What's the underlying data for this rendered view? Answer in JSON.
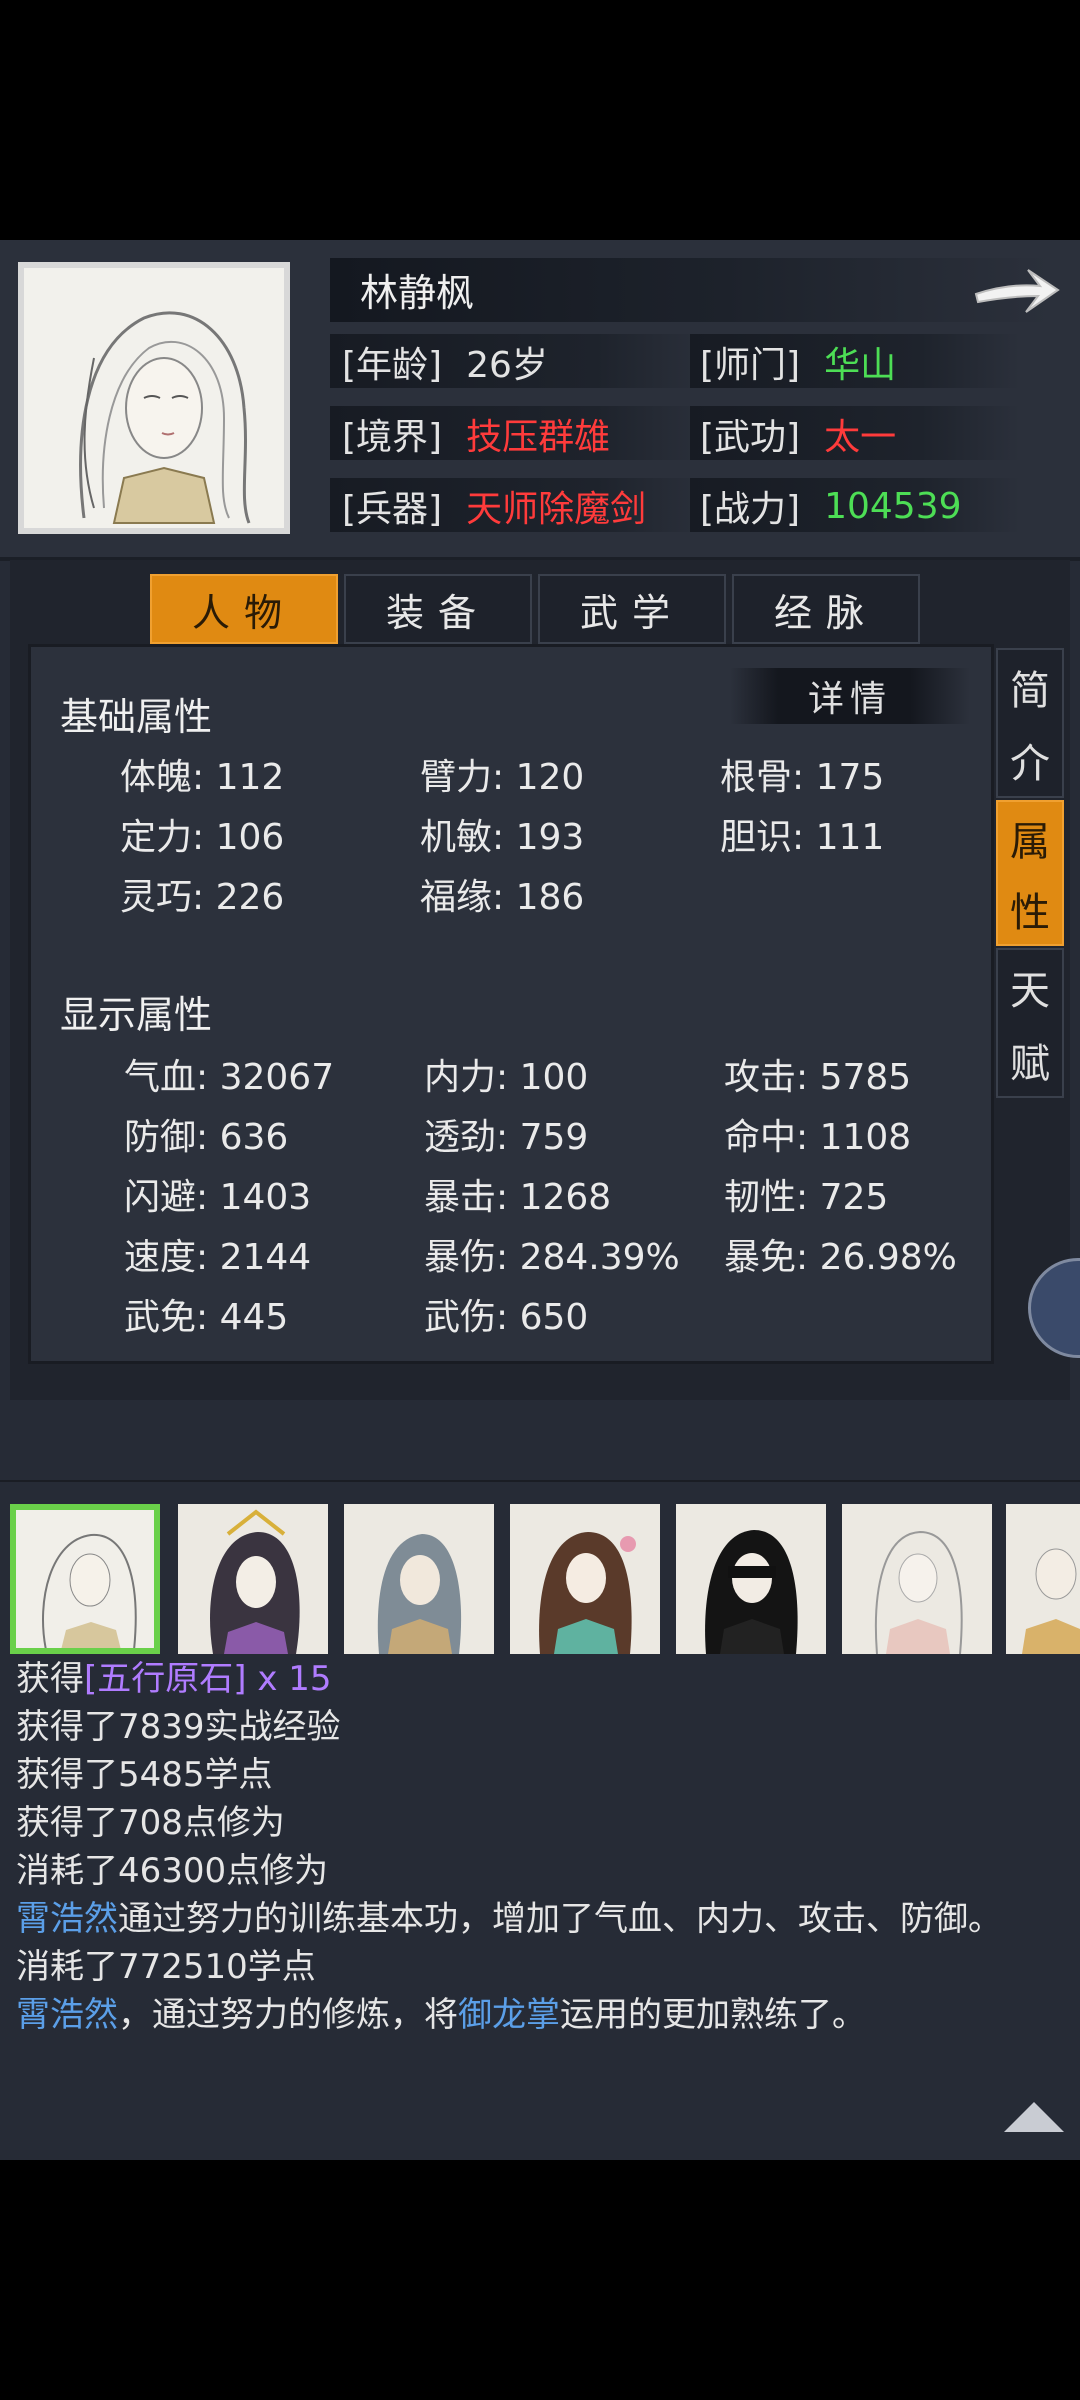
{
  "header": {
    "name": "林静枫",
    "age_label": "[年龄]",
    "age_value": "26岁",
    "sect_label": "[师门]",
    "sect_value": "华山",
    "realm_label": "[境界]",
    "realm_value": "技压群雄",
    "skill_label": "[武功]",
    "skill_value": "太一",
    "weapon_label": "[兵器]",
    "weapon_value": "天师除魔剑",
    "power_label": "[战力]",
    "power_value": "104539"
  },
  "tabs": [
    {
      "label": "人物",
      "active": true
    },
    {
      "label": "装备",
      "active": false
    },
    {
      "label": "武学",
      "active": false
    },
    {
      "label": "经脉",
      "active": false
    }
  ],
  "side_tabs": [
    {
      "label": [
        "简",
        "介"
      ],
      "active": false
    },
    {
      "label": [
        "属",
        "性"
      ],
      "active": true
    },
    {
      "label": [
        "天",
        "赋"
      ],
      "active": false
    }
  ],
  "details_label": "详情",
  "basic": {
    "title": "基础属性",
    "stats": [
      "体魄: 112",
      "臂力: 120",
      "根骨: 175",
      "定力: 106",
      "机敏: 193",
      "胆识: 111",
      "灵巧: 226",
      "福缘: 186"
    ]
  },
  "display": {
    "title": "显示属性",
    "stats": [
      "气血: 32067",
      "内力: 100",
      "攻击: 5785",
      "防御: 636",
      "透劲: 759",
      "命中: 1108",
      "闪避: 1403",
      "暴击: 1268",
      "韧性: 725",
      "速度: 2144",
      "暴伤: 284.39%",
      "暴免: 26.98%",
      "武免: 445",
      "武伤: 650"
    ]
  },
  "log": {
    "line1_a": "获得",
    "line1_item": "[五行原石]",
    "line1_b": " x 15",
    "line2": "获得了7839实战经验",
    "line3": "获得了5485学点",
    "line4": "获得了708点修为",
    "line5": "消耗了46300点修为",
    "line6_name": "霄浩然",
    "line6_rest": "通过努力的训练基本功，增加了气血、内力、攻击、防御。",
    "line7": "消耗了772510学点",
    "line8_name": "霄浩然",
    "line8_mid": "，通过努力的修炼，将",
    "line8_skill": "御龙掌",
    "line8_end": "运用的更加熟练了。"
  },
  "colors": {
    "accent": "#e08a12",
    "red": "#ff3b3b",
    "green": "#4dde55",
    "purple": "#b07cff",
    "blue": "#5b9fe8"
  }
}
